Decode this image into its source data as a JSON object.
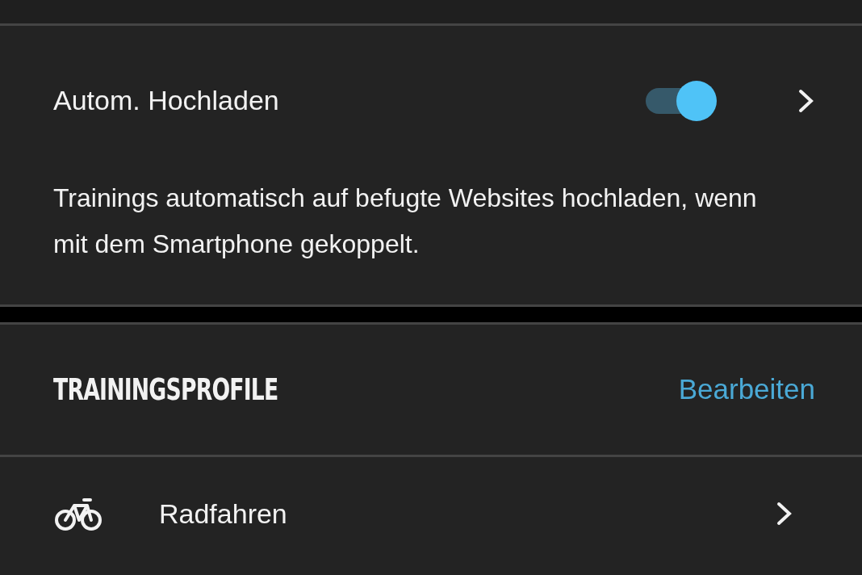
{
  "auto_upload": {
    "label": "Autom. Hochladen",
    "on": true,
    "description": "Trainings automatisch auf befugte Websites hochladen, wenn mit dem Smartphone gekoppelt."
  },
  "section": {
    "title": "TRAININGSPROFILE",
    "action": "Bearbeiten"
  },
  "profiles": [
    {
      "label": "Radfahren"
    }
  ]
}
